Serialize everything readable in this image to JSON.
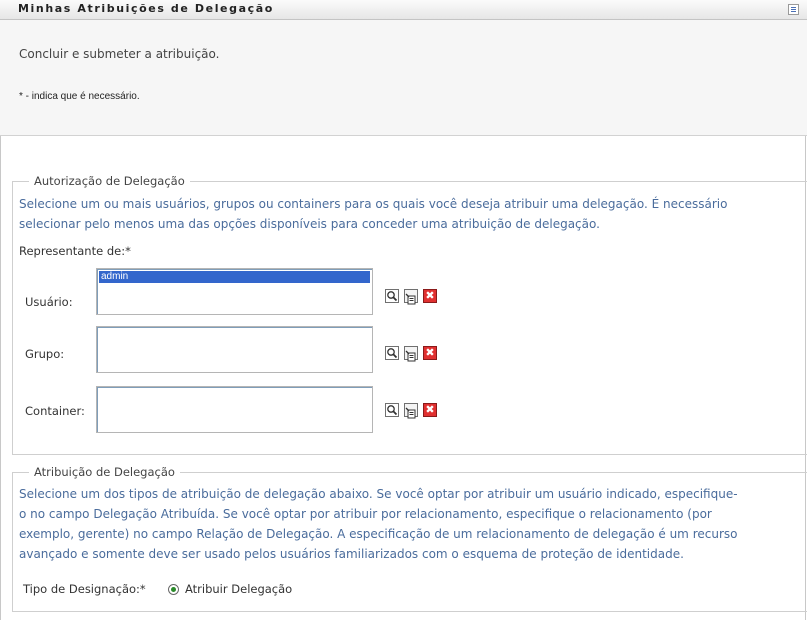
{
  "window": {
    "title": "Minhas Atribuições de Delegação",
    "menu_icon": "menu-grid-icon"
  },
  "header": {
    "subtitle": "Concluir e submeter a atribuição.",
    "required_note": "* - indica que é necessário."
  },
  "authorization": {
    "legend": "Autorização de Delegação",
    "desc_line1": "Selecione um ou mais usuários, grupos ou containers para os quais você deseja atribuir uma delegação. É necessário",
    "desc_line2": "selecionar pelo menos uma das opções disponíveis para conceder uma atribuição de delegação.",
    "represent_label": "Representante de:*",
    "fields": {
      "user": {
        "label": "Usuário:",
        "items": [
          "admin"
        ]
      },
      "group": {
        "label": "Grupo:",
        "items": []
      },
      "container": {
        "label": "Container:",
        "items": []
      }
    },
    "icons": {
      "search": "search-icon",
      "history": "history-icon",
      "clear": "clear-icon"
    },
    "colors": {
      "description_text": "#4a6c9c",
      "selected_item": "#3366cc",
      "clear_button": "#e03030"
    }
  },
  "assignment": {
    "legend": "Atribuição de Delegação",
    "desc_line1": "Selecione um dos tipos de atribuição de delegação abaixo. Se você optar por atribuir um usuário indicado, especifique-",
    "desc_line2": "o no campo Delegação Atribuída. Se você optar por atribuir por relacionamento, especifique o relacionamento (por",
    "desc_line3": "exemplo, gerente) no campo Relação de Delegação. A especificação de um relacionamento de delegação é um recurso",
    "desc_line4": "avançado e somente deve ser usado pelos usuários familiarizados com o esquema de proteção de identidade.",
    "type_label": "Tipo de Designação:*",
    "type_option": "Atribuir Delegação"
  }
}
